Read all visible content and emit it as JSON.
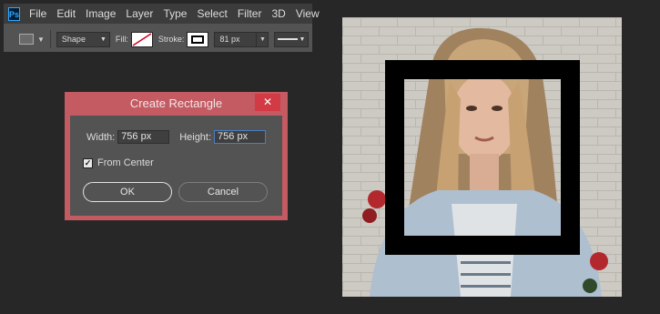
{
  "app": {
    "logo": "Ps"
  },
  "menu": [
    "File",
    "Edit",
    "Image",
    "Layer",
    "Type",
    "Select",
    "Filter",
    "3D",
    "View"
  ],
  "options": {
    "mode": "Shape",
    "fill_label": "Fill:",
    "stroke_label": "Stroke:",
    "stroke_width": "81 px",
    "icons": {
      "tool": "rectangle-tool-icon",
      "chevron": "chevron-down-icon",
      "fill_none": "no-fill-icon",
      "stroke_swatch": "stroke-color-icon",
      "line_style": "stroke-style-icon"
    }
  },
  "dialog": {
    "title": "Create Rectangle",
    "close_icon": "close-icon",
    "width_label": "Width:",
    "width_value": "756 px",
    "height_label": "Height:",
    "height_value": "756 px",
    "from_center_label": "From Center",
    "from_center_checked": true,
    "ok_label": "OK",
    "cancel_label": "Cancel"
  },
  "colors": {
    "dialog_accent": "#c45a62",
    "close_button": "#d23b45",
    "panel": "#535353",
    "workspace": "#272727",
    "rect_stroke": "#000000"
  }
}
